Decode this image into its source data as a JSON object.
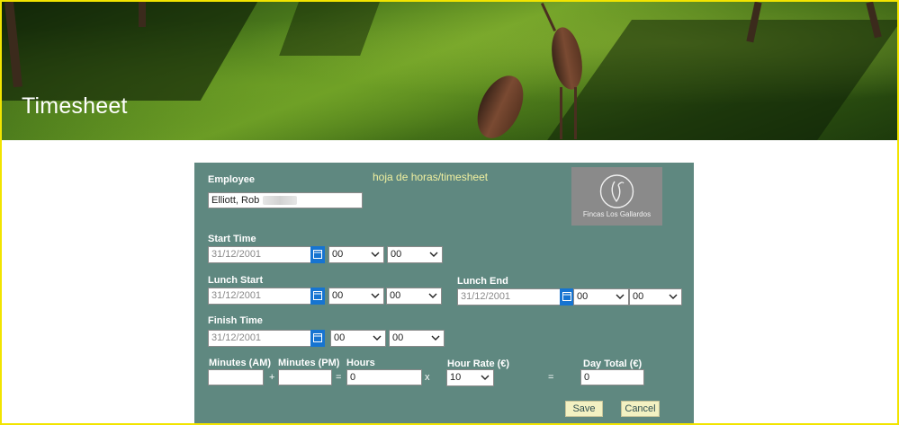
{
  "banner": {
    "title": "Timesheet"
  },
  "form": {
    "heading": "hoja de horas/timesheet",
    "logo": {
      "brand_text": "Fincas Los Gallardos"
    },
    "employee": {
      "label": "Employee",
      "value": "Elliott, Rob"
    },
    "start_time": {
      "label": "Start Time",
      "date": "31/12/2001",
      "hour": "00",
      "minute": "00"
    },
    "lunch_start": {
      "label": "Lunch Start",
      "date": "31/12/2001",
      "hour": "00",
      "minute": "00"
    },
    "lunch_end": {
      "label": "Lunch End",
      "date": "31/12/2001",
      "hour": "00",
      "minute": "00"
    },
    "finish_time": {
      "label": "Finish Time",
      "date": "31/12/2001",
      "hour": "00",
      "minute": "00"
    },
    "calc": {
      "minutes_am_label": "Minutes (AM)",
      "minutes_pm_label": "Minutes (PM)",
      "hours_label": "Hours",
      "hour_rate_label": "Hour Rate (€)",
      "day_total_label": "Day Total (€)",
      "minutes_am_value": "",
      "minutes_pm_value": "",
      "hours_value": "0",
      "hour_rate_value": "10",
      "day_total_value": "0",
      "plus": "+",
      "equals": "=",
      "times": "x"
    },
    "save_label": "Save",
    "cancel_label": "Cancel"
  },
  "colors": {
    "panel": "#5f8880",
    "frame": "#f2e400",
    "calendar_button": "#1674d1",
    "heading": "#f0f0a0",
    "button_bg": "#f3f1c2"
  },
  "icons": {
    "calendar": "calendar-icon",
    "dropdown": "chevron-down-icon",
    "logo": "bird-logo-icon"
  }
}
